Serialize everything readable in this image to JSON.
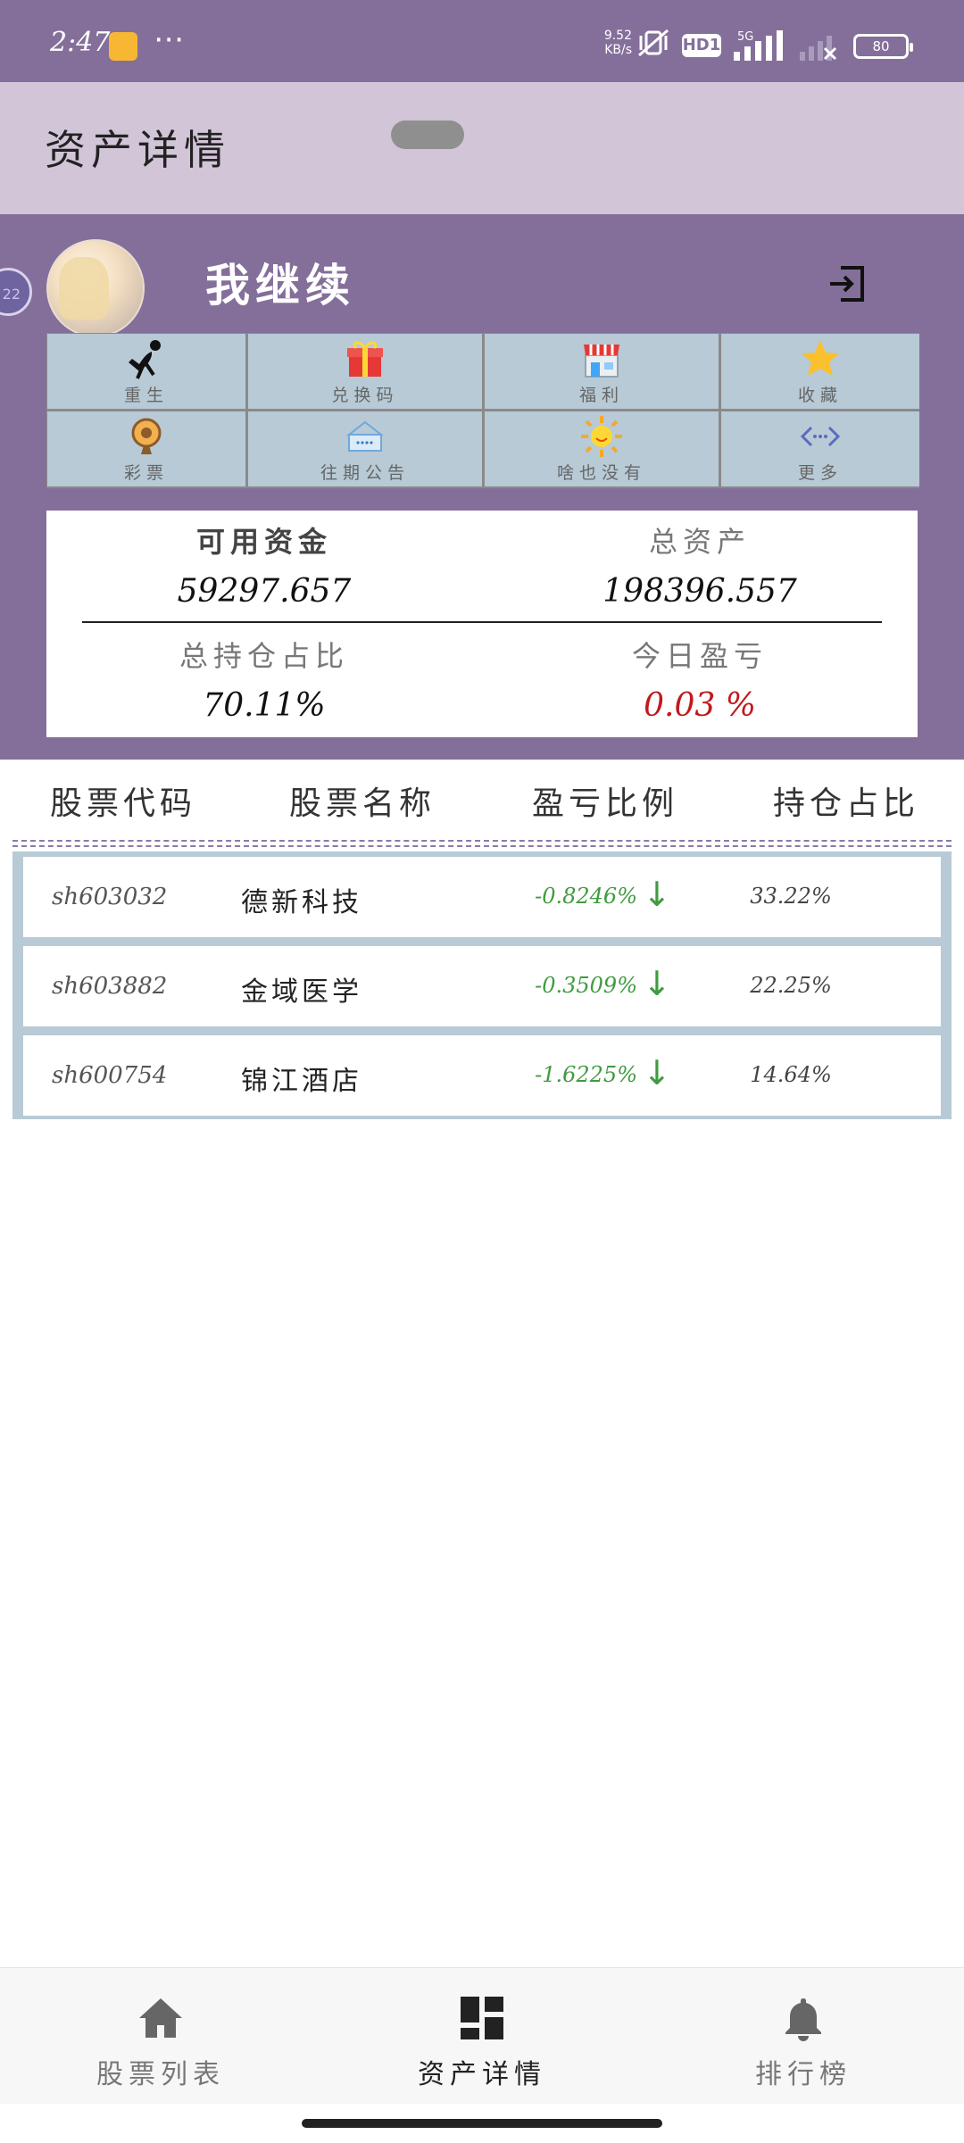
{
  "status_bar": {
    "time": "2:47",
    "more": "⋯",
    "net_speed": "9.52",
    "net_unit": "KB/s",
    "hd": "HD1",
    "net_type": "5G",
    "battery": "80"
  },
  "header": {
    "title": "资产详情"
  },
  "profile": {
    "username": "我继续",
    "side_bubble": "22"
  },
  "menu": [
    {
      "label": "重生",
      "icon": "rebirth-figure-icon"
    },
    {
      "label": "兑换码",
      "icon": "gift-icon"
    },
    {
      "label": "福利",
      "icon": "shop-icon"
    },
    {
      "label": "收藏",
      "icon": "star-icon"
    },
    {
      "label": "彩票",
      "icon": "lottery-wheel-icon"
    },
    {
      "label": "往期公告",
      "icon": "announcement-icon"
    },
    {
      "label": "啥也没有",
      "icon": "sun-icon"
    },
    {
      "label": "更多",
      "icon": "more-code-icon"
    }
  ],
  "assets": {
    "available_label": "可用资金",
    "available_value": "59297.657",
    "total_label": "总资产",
    "total_value": "198396.557",
    "position_ratio_label": "总持仓占比",
    "position_ratio_value": "70.11%",
    "today_pl_label": "今日盈亏",
    "today_pl_value": "0.03 %",
    "today_pl_color": "#C0191E"
  },
  "table": {
    "headers": [
      "股票代码",
      "股票名称",
      "盈亏比例",
      "持仓占比"
    ],
    "rows": [
      {
        "code": "sh603032",
        "name": "德新科技",
        "pl": "-0.8246%",
        "arrow": "↓",
        "ratio": "33.22%"
      },
      {
        "code": "sh603882",
        "name": "金域医学",
        "pl": "-0.3509%",
        "arrow": "↓",
        "ratio": "22.25%"
      },
      {
        "code": "sh600754",
        "name": "锦江酒店",
        "pl": "-1.6225%",
        "arrow": "↓",
        "ratio": "14.64%"
      }
    ],
    "down_color": "#3F9B3F"
  },
  "bottom_nav": [
    {
      "label": "股票列表",
      "icon": "home-icon",
      "active": false
    },
    {
      "label": "资产详情",
      "icon": "dashboard-icon",
      "active": true
    },
    {
      "label": "排行榜",
      "icon": "bell-icon",
      "active": false
    }
  ],
  "colors": {
    "accent": "#846F9B",
    "header_bg": "#D2C5D8",
    "grid_bg": "#B7CAD6"
  }
}
